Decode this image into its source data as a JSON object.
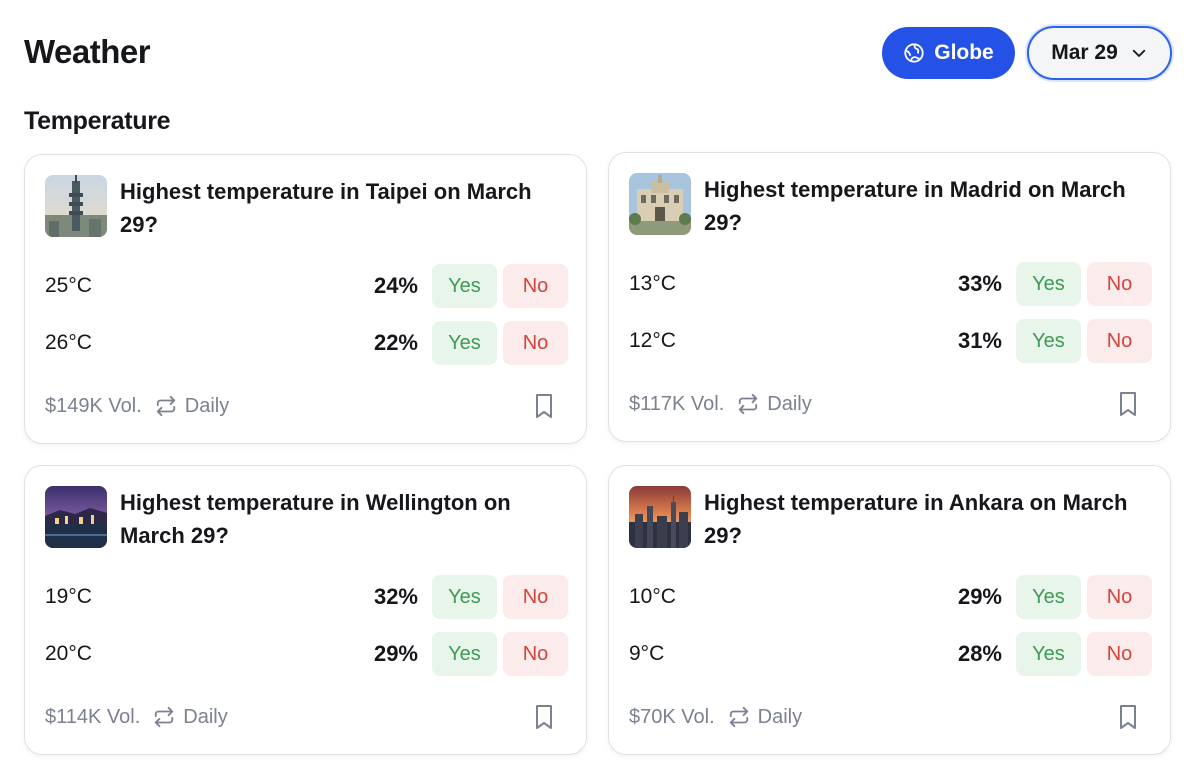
{
  "header": {
    "title": "Weather",
    "globe_label": "Globe",
    "date_value": "Mar 29"
  },
  "section_title": "Temperature",
  "colors": {
    "accent": "#2552e6",
    "yes_bg": "#e8f5ea",
    "yes_text": "#3f9a55",
    "no_bg": "#fbeceb",
    "no_text": "#d3453c"
  },
  "cards": [
    {
      "title": "Highest temperature in Taipei on March 29?",
      "outcomes": [
        {
          "label": "25°C",
          "pct": "24%",
          "yes": "Yes",
          "no": "No"
        },
        {
          "label": "26°C",
          "pct": "22%",
          "yes": "Yes",
          "no": "No"
        }
      ],
      "volume": "$149K Vol.",
      "frequency": "Daily"
    },
    {
      "title": "Highest temperature in Madrid on March 29?",
      "outcomes": [
        {
          "label": "13°C",
          "pct": "33%",
          "yes": "Yes",
          "no": "No"
        },
        {
          "label": "12°C",
          "pct": "31%",
          "yes": "Yes",
          "no": "No"
        }
      ],
      "volume": "$117K Vol.",
      "frequency": "Daily"
    },
    {
      "title": "Highest temperature in Wellington on March 29?",
      "outcomes": [
        {
          "label": "19°C",
          "pct": "32%",
          "yes": "Yes",
          "no": "No"
        },
        {
          "label": "20°C",
          "pct": "29%",
          "yes": "Yes",
          "no": "No"
        }
      ],
      "volume": "$114K Vol.",
      "frequency": "Daily"
    },
    {
      "title": "Highest temperature in Ankara on March 29?",
      "outcomes": [
        {
          "label": "10°C",
          "pct": "29%",
          "yes": "Yes",
          "no": "No"
        },
        {
          "label": "9°C",
          "pct": "28%",
          "yes": "Yes",
          "no": "No"
        }
      ],
      "volume": "$70K Vol.",
      "frequency": "Daily"
    }
  ]
}
